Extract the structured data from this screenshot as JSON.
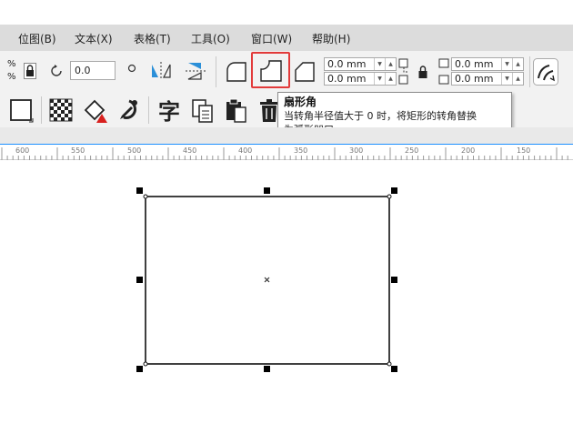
{
  "menu": {
    "items": [
      {
        "label": "位图(B)"
      },
      {
        "label": "文本(X)"
      },
      {
        "label": "表格(T)"
      },
      {
        "label": "工具(O)"
      },
      {
        "label": "窗口(W)"
      },
      {
        "label": "帮助(H)"
      }
    ]
  },
  "propbar": {
    "percent_top": "%",
    "percent_bottom": "%",
    "rotation_value": "0.0",
    "corner_radius_tl": "0.0 mm",
    "corner_radius_bl": "0.0 mm",
    "corner_radius_tr": "0.0 mm",
    "corner_radius_br": "0.0 mm"
  },
  "tooltip": {
    "title": "扇形角",
    "line1": "当转角半径值大于 0 时，将矩形的转角替换",
    "line2": "为弧形凹口."
  },
  "ruler": {
    "labels": [
      "600",
      "550",
      "500",
      "450",
      "400",
      "350",
      "300",
      "250",
      "200",
      "150"
    ]
  },
  "icons": {
    "lock": "lock-icon",
    "rotate": "rotate-icon",
    "round_corner": "round-corner-icon",
    "scallop_corner": "scalloped-corner-icon",
    "chamfer_corner": "chamfered-corner-icon",
    "selection_mode": "highlight-accent"
  },
  "colors": {
    "highlight": "#e23a3a",
    "ruler_accent": "#1e90ff",
    "menubar": "#dcdcdc",
    "toolbar": "#f2f2f2"
  }
}
